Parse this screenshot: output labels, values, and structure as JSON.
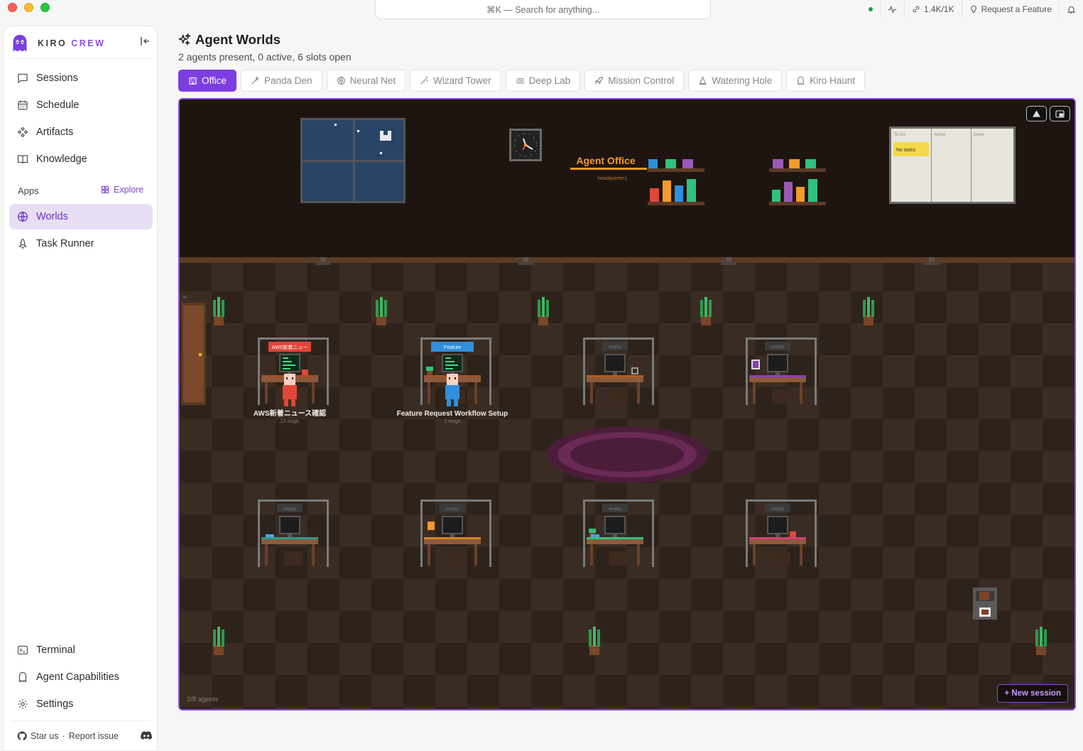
{
  "titlebar": {
    "search_placeholder": "⌘K — Search for anything...",
    "usage": "1.4K/1K",
    "request_feature": "Request a Feature"
  },
  "sidebar": {
    "brand_left": "KIRO",
    "brand_right": "CREW",
    "nav": [
      {
        "label": "Sessions",
        "icon": "chat-bubble-icon"
      },
      {
        "label": "Schedule",
        "icon": "calendar-icon"
      },
      {
        "label": "Artifacts",
        "icon": "artifacts-icon"
      },
      {
        "label": "Knowledge",
        "icon": "book-icon"
      }
    ],
    "apps_label": "Apps",
    "explore_label": "Explore",
    "apps": [
      {
        "label": "Worlds",
        "icon": "globe-icon",
        "active": true
      },
      {
        "label": "Task Runner",
        "icon": "rocket-icon"
      }
    ],
    "bottom": [
      {
        "label": "Terminal",
        "icon": "terminal-icon"
      },
      {
        "label": "Agent Capabilities",
        "icon": "ghost-icon"
      },
      {
        "label": "Settings",
        "icon": "gear-icon"
      }
    ],
    "footer": {
      "star": "Star us",
      "separator": "·",
      "report": "Report issue"
    }
  },
  "main": {
    "title": "Agent Worlds",
    "subtitle": "2 agents present, 0 active, 6 slots open",
    "tabs": [
      {
        "label": "Office",
        "active": true
      },
      {
        "label": "Panda Den"
      },
      {
        "label": "Neural Net"
      },
      {
        "label": "Wizard Tower"
      },
      {
        "label": "Deep Lab"
      },
      {
        "label": "Mission Control"
      },
      {
        "label": "Watering Hole"
      },
      {
        "label": "Kiro Haunt"
      }
    ]
  },
  "world": {
    "sign_title": "Agent Office",
    "sign_sub": "headquarters",
    "door_label": "IN",
    "board": {
      "columns": [
        "To Do",
        "Active",
        "Done"
      ],
      "note": "No tasks"
    },
    "agents": [
      {
        "tag": "AWS新着ニュー",
        "name": "AWS新着ニュース確認",
        "msgs": "13 msgs",
        "color": "#e0463a"
      },
      {
        "tag": "Feature",
        "name": "Feature Request Workflow Setup",
        "msgs": "2 msgs",
        "color": "#2f8fdc"
      }
    ],
    "empty_label": "empty",
    "agents_count": "2/8 agents",
    "new_session": "+ New session"
  },
  "colors": {
    "accent": "#7d3de0",
    "active_bg": "#e7def4"
  }
}
